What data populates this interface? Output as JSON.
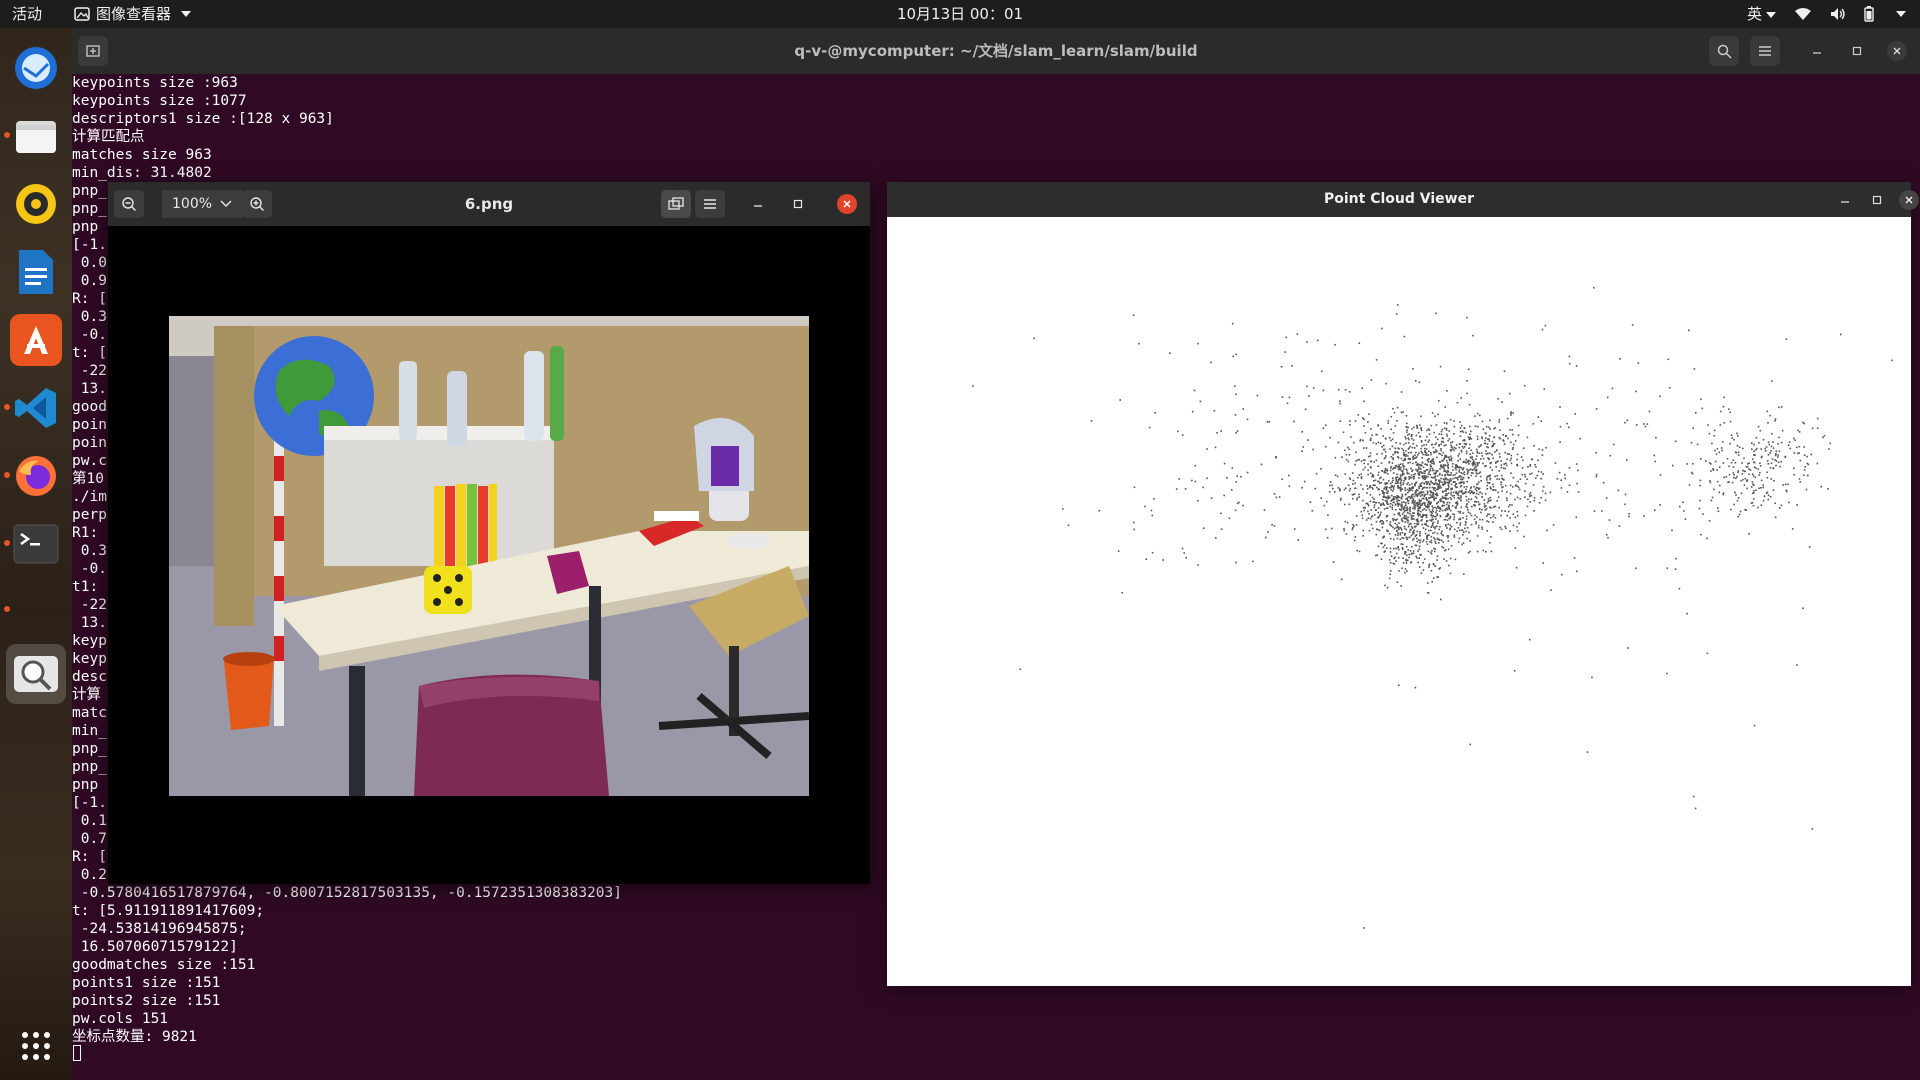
{
  "topbar": {
    "activities": "活动",
    "app_menu": "图像查看器",
    "clock": "10月13日  00：01",
    "input_method": "英"
  },
  "dock": {
    "items": [
      {
        "name": "thunderbird",
        "icon": "mail-bird-icon"
      },
      {
        "name": "files",
        "icon": "folder-icon"
      },
      {
        "name": "rhythmbox",
        "icon": "music-icon"
      },
      {
        "name": "writer",
        "icon": "document-icon"
      },
      {
        "name": "software",
        "icon": "app-store-icon"
      },
      {
        "name": "vscode",
        "icon": "code-editor-icon"
      },
      {
        "name": "firefox",
        "icon": "browser-icon"
      },
      {
        "name": "terminal",
        "icon": "terminal-icon"
      },
      {
        "name": "image-viewer",
        "icon": "image-viewer-icon"
      },
      {
        "name": "show-apps",
        "icon": "app-grid-icon"
      }
    ]
  },
  "terminal": {
    "title": "q-v-@mycomputer: ~/文档/slam_learn/slam/build",
    "lines": [
      "keypoints size :963",
      "keypoints size :1077",
      "descriptors1 size :[128 x 963]",
      "计算匹配点",
      "matches size 963",
      "min_dis: 31.4802",
      "pnp_",
      "pnp_",
      "pnp",
      "[-1.",
      " 0.0",
      " 0.9",
      "R: [",
      " 0.3",
      " -0.",
      "t: [",
      " -22",
      " 13.",
      "good",
      "poin",
      "poin",
      "pw.c",
      "第10",
      "./im",
      "perp",
      "R1:",
      " 0.3",
      " -0.",
      "t1:",
      " -22",
      " 13.",
      "keyp",
      "keyp",
      "desc",
      "计算",
      "matc",
      "min_",
      "pnp_",
      "pnp_",
      "pnp",
      "[-1.",
      " 0.1",
      " 0.7",
      "R: [",
      " 0.2",
      " -0.5780416517879764, -0.8007152817503135, -0.1572351308383203]",
      "t: [5.911911891417609;",
      " -24.53814196945875;",
      " 16.50706071579122]",
      "goodmatches size :151",
      "points1 size :151",
      "points2 size :151",
      "pw.cols 151",
      "坐标点数量: 9821"
    ]
  },
  "image_viewer": {
    "title": "6.png",
    "zoom": "100%"
  },
  "point_cloud_viewer": {
    "title": "Point Cloud Viewer"
  },
  "colors": {
    "terminal_bg": "#300a24",
    "accent": "#e95420",
    "close_red": "#e0452b"
  }
}
